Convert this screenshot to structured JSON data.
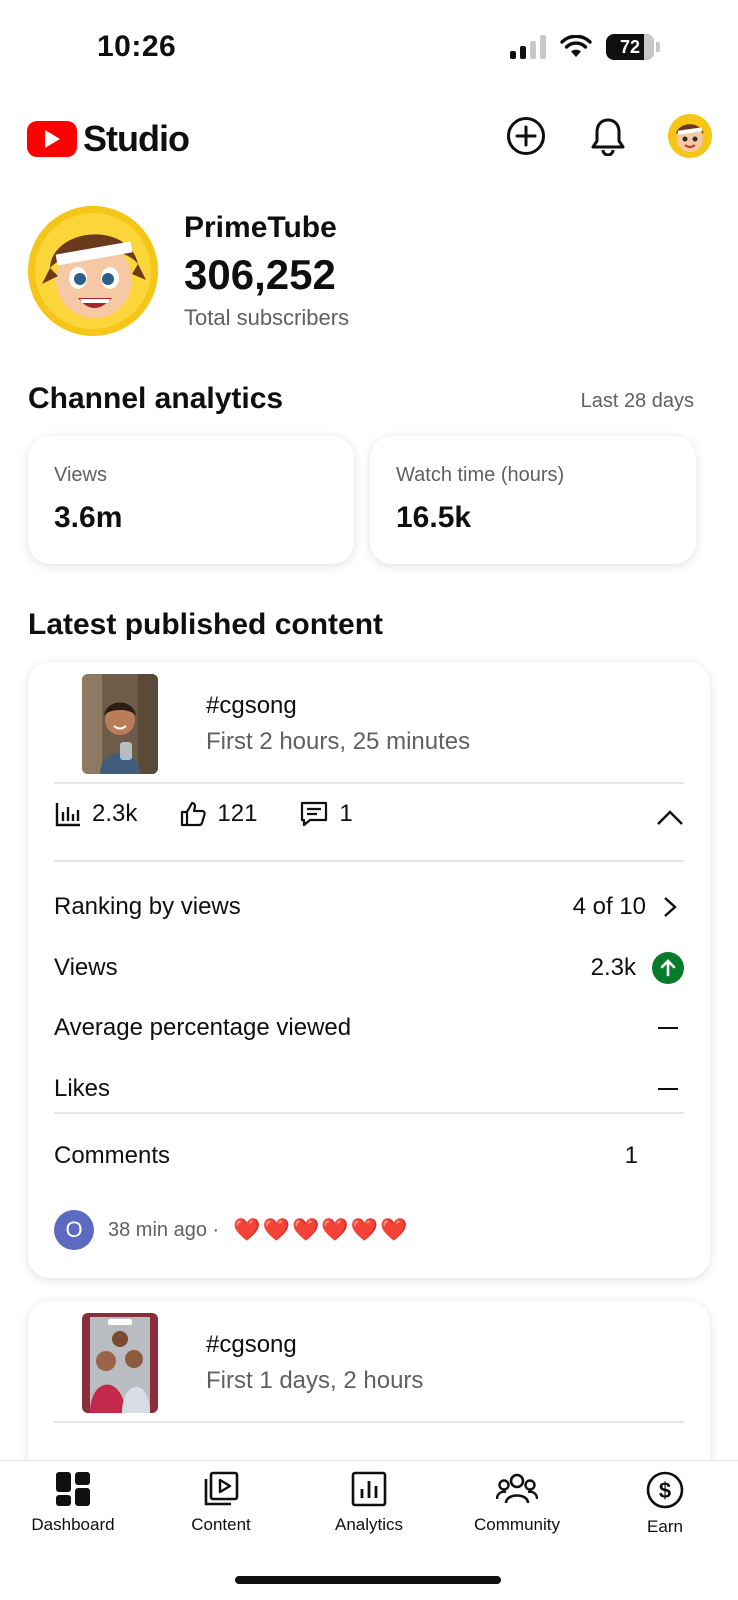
{
  "status_bar": {
    "time": "10:26",
    "battery": "72"
  },
  "header": {
    "logo_text": "Studio"
  },
  "channel": {
    "name": "PrimeTube",
    "subscribers": "306,252",
    "subscribers_label": "Total subscribers"
  },
  "analytics": {
    "title": "Channel analytics",
    "period": "Last 28 days",
    "metrics": [
      {
        "label": "Views",
        "value": "3.6m"
      },
      {
        "label": "Watch time (hours)",
        "value": "16.5k"
      }
    ]
  },
  "latest": {
    "title": "Latest published content",
    "videos": [
      {
        "title": "#cgsong",
        "subtitle": "First 2 hours, 25 minutes",
        "views": "2.3k",
        "likes": "121",
        "comments": "1",
        "details": [
          {
            "label": "Ranking by views",
            "value": "4 of 10"
          },
          {
            "label": "Views",
            "value": "2.3k"
          },
          {
            "label": "Average percentage viewed",
            "value": "—"
          },
          {
            "label": "Likes",
            "value": "—"
          }
        ],
        "comments_label": "Comments",
        "comments_count": "1",
        "latest_comment": {
          "initial": "O",
          "time": "38 min ago ·",
          "text": "❤️❤️❤️❤️❤️❤️"
        }
      },
      {
        "title": "#cgsong",
        "subtitle": "First 1 days, 2 hours"
      }
    ]
  },
  "nav": [
    {
      "label": "Dashboard",
      "icon": "dashboard-icon"
    },
    {
      "label": "Content",
      "icon": "content-icon"
    },
    {
      "label": "Analytics",
      "icon": "analytics-icon"
    },
    {
      "label": "Community",
      "icon": "community-icon"
    },
    {
      "label": "Earn",
      "icon": "earn-icon"
    }
  ],
  "colors": {
    "accent": "#ff0000",
    "up": "#067c2a",
    "comment_avatar": "#5c6bc0"
  }
}
